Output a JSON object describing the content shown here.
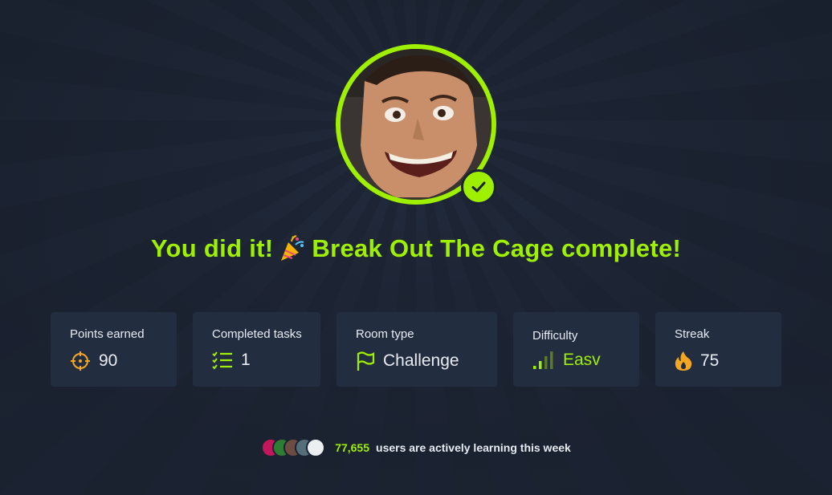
{
  "headline": {
    "part1": "You did it!",
    "part2": "Break Out The Cage complete!"
  },
  "stats": {
    "points": {
      "label": "Points earned",
      "value": "90",
      "icon": "crosshair-icon"
    },
    "tasks": {
      "label": "Completed tasks",
      "value": "1",
      "icon": "checklist-icon"
    },
    "room_type": {
      "label": "Room type",
      "value": "Challenge",
      "icon": "flag-icon"
    },
    "difficulty": {
      "label": "Difficulty",
      "value": "Easv",
      "icon": "signal-bars-icon"
    },
    "streak": {
      "label": "Streak",
      "value": "75",
      "icon": "fire-icon"
    }
  },
  "activity": {
    "count": "77,655",
    "text": "users are actively learning this week"
  },
  "colors": {
    "accent": "#9fef00",
    "card": "#232d40",
    "background": "#1b2231",
    "points_icon": "#f5a623",
    "streak_icon": "#f5a623"
  }
}
